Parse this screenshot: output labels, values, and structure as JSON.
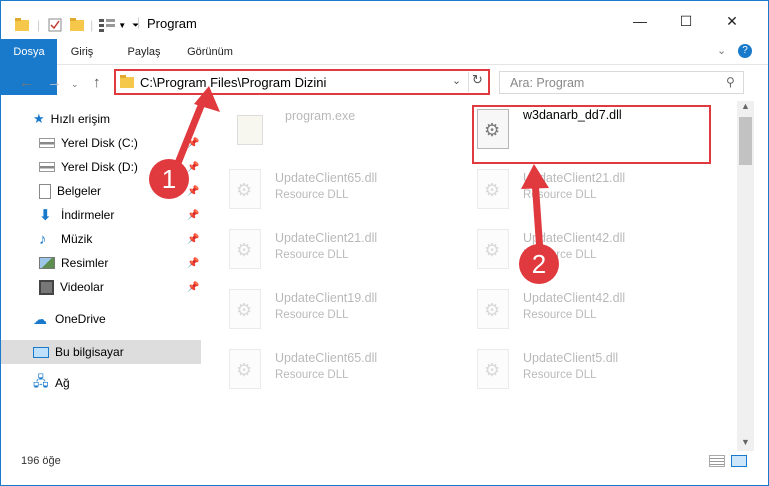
{
  "window": {
    "title": "Program"
  },
  "ribbon": {
    "tabs": [
      "Dosya",
      "Giriş",
      "Paylaş",
      "Görünüm"
    ]
  },
  "address": {
    "path": "C:\\Program Files\\Program Dizini"
  },
  "search": {
    "placeholder": "Ara: Program"
  },
  "nav": {
    "quick_access": "Hızlı erişim",
    "items": [
      {
        "label": "Yerel Disk (C:)",
        "icon": "drive-icon",
        "pinned": true
      },
      {
        "label": "Yerel Disk (D:)",
        "icon": "drive-icon",
        "pinned": true
      },
      {
        "label": "Belgeler",
        "icon": "documents-icon",
        "pinned": true
      },
      {
        "label": "İndirmeler",
        "icon": "download-icon",
        "pinned": true
      },
      {
        "label": "Müzik",
        "icon": "music-icon",
        "pinned": true
      },
      {
        "label": "Resimler",
        "icon": "pictures-icon",
        "pinned": true
      },
      {
        "label": "Videolar",
        "icon": "video-icon",
        "pinned": true
      }
    ],
    "onedrive": "OneDrive",
    "this_pc": "Bu bilgisayar",
    "network": "Ağ"
  },
  "files": {
    "highlighted": {
      "name": "w3danarb_dd7.dll"
    },
    "top": {
      "name": "program.exe"
    },
    "grid": [
      {
        "name": "UpdateClient65.dll",
        "desc": "Resource DLL"
      },
      {
        "name": "UpdateClient21.dll",
        "desc": "Resource DLL"
      },
      {
        "name": "UpdateClient21.dll",
        "desc": "Resource DLL"
      },
      {
        "name": "UpdateClient42.dll",
        "desc": "Resource DLL"
      },
      {
        "name": "UpdateClient19.dll",
        "desc": "Resource DLL"
      },
      {
        "name": "UpdateClient42.dll",
        "desc": "Resource DLL"
      },
      {
        "name": "UpdateClient65.dll",
        "desc": "Resource DLL"
      },
      {
        "name": "UpdateClient5.dll",
        "desc": "Resource DLL"
      }
    ]
  },
  "status": {
    "count": "196 öğe"
  },
  "annotations": {
    "badge1": "1",
    "badge2": "2"
  },
  "colors": {
    "accent": "#1979ca",
    "annotation": "#e0393e"
  }
}
